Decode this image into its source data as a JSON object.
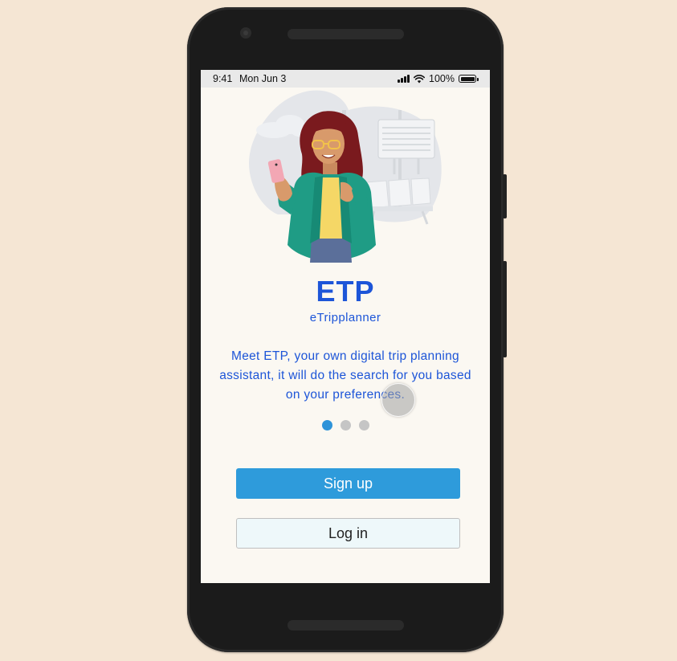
{
  "status_bar": {
    "time": "9:41",
    "date": "Mon Jun 3",
    "battery": "100%"
  },
  "app": {
    "title": "ETP",
    "subtitle": "eTripplanner",
    "description": "Meet ETP, your own digital trip planning assistant, it will do the search for you based on your preferences."
  },
  "pagination": {
    "total": 3,
    "active_index": 0
  },
  "actions": {
    "signup_label": "Sign up",
    "login_label": "Log in"
  },
  "colors": {
    "accent_text": "#1d55d8",
    "primary_button": "#2e9bdb",
    "secondary_button": "#eef8fa",
    "page_background": "#f5e6d4",
    "screen_background": "#fbf8f2"
  },
  "icons": [
    "signal-icon",
    "wifi-icon",
    "battery-icon",
    "camera-icon",
    "speaker-icon"
  ]
}
